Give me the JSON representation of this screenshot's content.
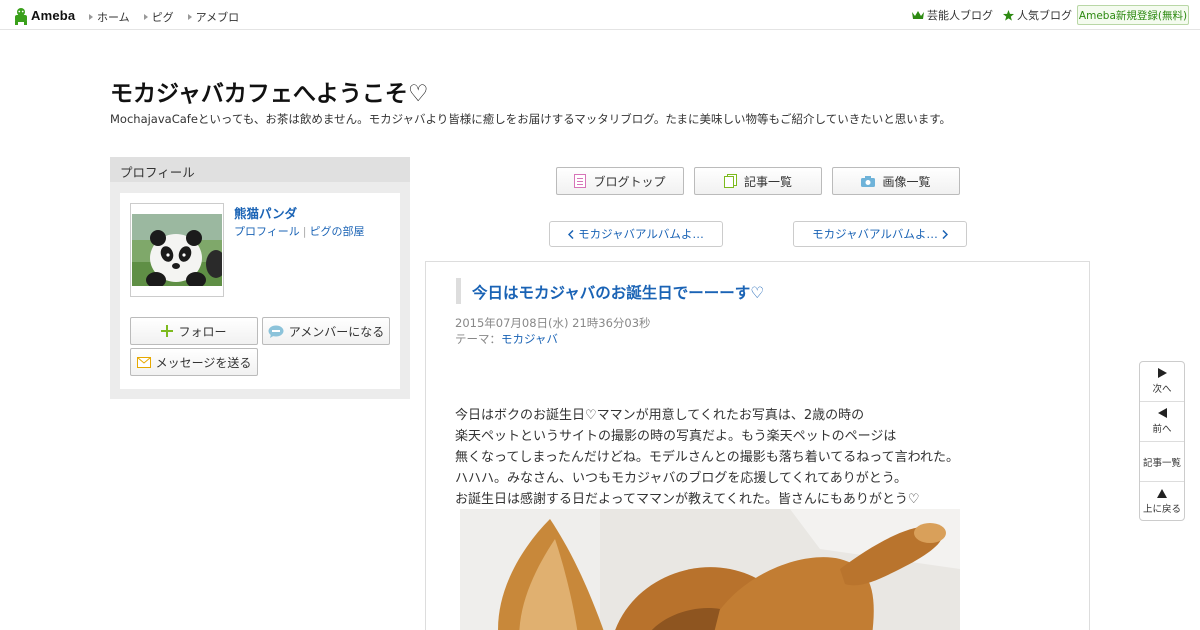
{
  "topbar": {
    "logo_text": "Ameba",
    "nav": [
      "ホーム",
      "ピグ",
      "アメブロ"
    ],
    "celebrity_blog": "芸能人ブログ",
    "popular_blog": "人気ブログ",
    "register": "Ameba新規登録(無料)"
  },
  "header": {
    "title": "モカジャバカフェへようこそ♡",
    "description": "MochajavaCafeといっても、お茶は飲めません。モカジャバより皆様に癒しをお届けするマッタリブログ。たまに美味しい物等もご紹介していきたいと思います。"
  },
  "profile": {
    "heading": "プロフィール",
    "name": "熊猫パンダ",
    "link_profile": "プロフィール",
    "link_pigg_room": "ピグの部屋",
    "follow": "フォロー",
    "amember": "アメンバーになる",
    "message": "メッセージを送る"
  },
  "main_nav": {
    "blog_top": "ブログトップ",
    "entry_list": "記事一覧",
    "image_list": "画像一覧",
    "prev_entry": "モカジャバアルバムよ…",
    "next_entry": "モカジャバアルバムよ…"
  },
  "article": {
    "title": "今日はモカジャバのお誕生日でーーーす♡",
    "date": "2015年07月08日(水) 21時36分03秒",
    "theme_label": "テーマ：",
    "theme": "モカジャバ",
    "body": [
      "今日はボクのお誕生日♡ママンが用意してくれたお写真は、2歳の時の",
      "楽天ペットというサイトの撮影の時の写真だよ。もう楽天ペットのページは",
      "無くなってしまったんだけどね。モデルさんとの撮影も落ち着いてるねって言われた。",
      "ハハハ。みなさん、いつもモカジャバのブログを応援してくれてありがとう。",
      "お誕生日は感謝する日だよってママンが教えてくれた。皆さんにもありがとう♡"
    ]
  },
  "side_nav": {
    "next": "次へ",
    "prev": "前へ",
    "list": "記事一覧",
    "top": "上に戻る"
  },
  "colors": {
    "link": "#1a63b5",
    "ameba_green": "#2d8a12"
  }
}
